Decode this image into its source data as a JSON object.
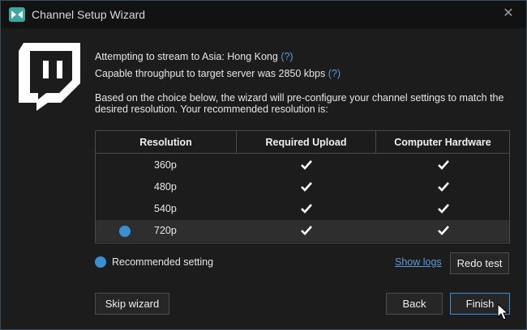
{
  "window": {
    "title": "Channel Setup Wizard",
    "close_label": "✕"
  },
  "info": {
    "stream_line": "Attempting to stream to Asia: Hong Kong",
    "throughput_line": "Capable throughput to target server was 2850 kbps",
    "help_mark": "(?)",
    "description_1": "Based on the choice below, the wizard will pre-configure your channel settings to match the",
    "description_2": "desired resolution. Your recommended resolution is:"
  },
  "table": {
    "headers": [
      "Resolution",
      "Required Upload",
      "Computer Hardware"
    ],
    "rows": [
      {
        "resolution": "360p",
        "upload_ok": true,
        "hardware_ok": true,
        "recommended": false
      },
      {
        "resolution": "480p",
        "upload_ok": true,
        "hardware_ok": true,
        "recommended": false
      },
      {
        "resolution": "540p",
        "upload_ok": true,
        "hardware_ok": true,
        "recommended": false
      },
      {
        "resolution": "720p",
        "upload_ok": true,
        "hardware_ok": true,
        "recommended": true
      }
    ]
  },
  "legend": {
    "label": "Recommended setting"
  },
  "actions": {
    "show_logs": "Show logs",
    "redo_test": "Redo test",
    "skip_wizard": "Skip wizard",
    "back": "Back",
    "finish": "Finish"
  },
  "colors": {
    "accent": "#3b8fd3",
    "link": "#5b9bd8",
    "background": "#1c1c1c"
  }
}
